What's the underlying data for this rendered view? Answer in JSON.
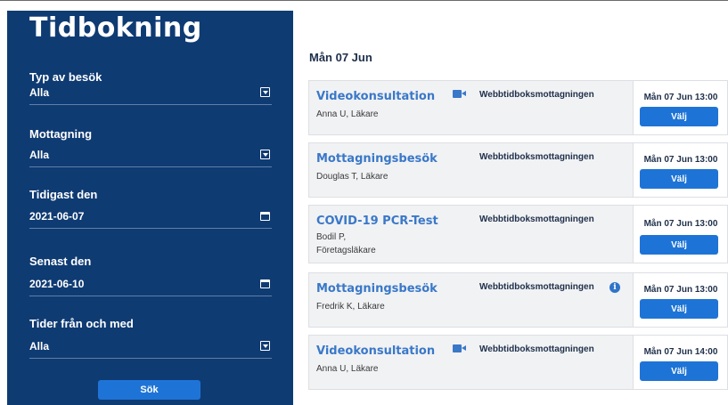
{
  "sidebar": {
    "title": "Tidbokning",
    "filters": [
      {
        "label": "Typ av besök",
        "value": "Alla",
        "control": "dropdown"
      },
      {
        "label": "Mottagning",
        "value": "Alla",
        "control": "dropdown"
      },
      {
        "label": "Tidigast den",
        "value": "2021-06-07",
        "control": "calendar"
      },
      {
        "label": "Senast den",
        "value": "2021-06-10",
        "control": "calendar"
      },
      {
        "label": "Tider från och med",
        "value": "Alla",
        "control": "dropdown"
      }
    ],
    "search_label": "Sök"
  },
  "main": {
    "date_heading": "Mån 07 Jun",
    "appointments": [
      {
        "type": "Videokonsultation",
        "lines": [
          "Anna U, Läkare"
        ],
        "video": true,
        "clinic": "Webbtidboksmottagningen",
        "info": false,
        "time": "Mån 07 Jun 13:00",
        "button": "Välj"
      },
      {
        "type": "Mottagningsbesök",
        "lines": [
          "Douglas T, Läkare"
        ],
        "video": false,
        "clinic": "Webbtidboksmottagningen",
        "info": false,
        "time": "Mån 07 Jun 13:00",
        "button": "Välj"
      },
      {
        "type": "COVID-19 PCR-Test",
        "lines": [
          "Bodil P,",
          "Företagsläkare"
        ],
        "video": false,
        "clinic": "Webbtidboksmottagningen",
        "info": false,
        "time": "Mån 07 Jun 13:00",
        "button": "Välj"
      },
      {
        "type": "Mottagningsbesök",
        "lines": [
          "Fredrik K, Läkare"
        ],
        "video": false,
        "clinic": "Webbtidboksmottagningen",
        "info": true,
        "time": "Mån 07 Jun 13:00",
        "button": "Välj"
      },
      {
        "type": "Videokonsultation",
        "lines": [
          "Anna U, Läkare"
        ],
        "video": true,
        "clinic": "Webbtidboksmottagningen",
        "info": false,
        "time": "Mån 07 Jun 14:00",
        "button": "Välj"
      }
    ]
  },
  "colors": {
    "sidebar_bg": "#0f3b73",
    "button_blue": "#1e74d6",
    "link_blue": "#3a78c8",
    "card_bg": "#f1f2f4"
  },
  "icons": {
    "dropdown": "chevron-down-icon",
    "calendar": "calendar-icon",
    "video": "video-camera-icon",
    "info": "info-icon"
  }
}
